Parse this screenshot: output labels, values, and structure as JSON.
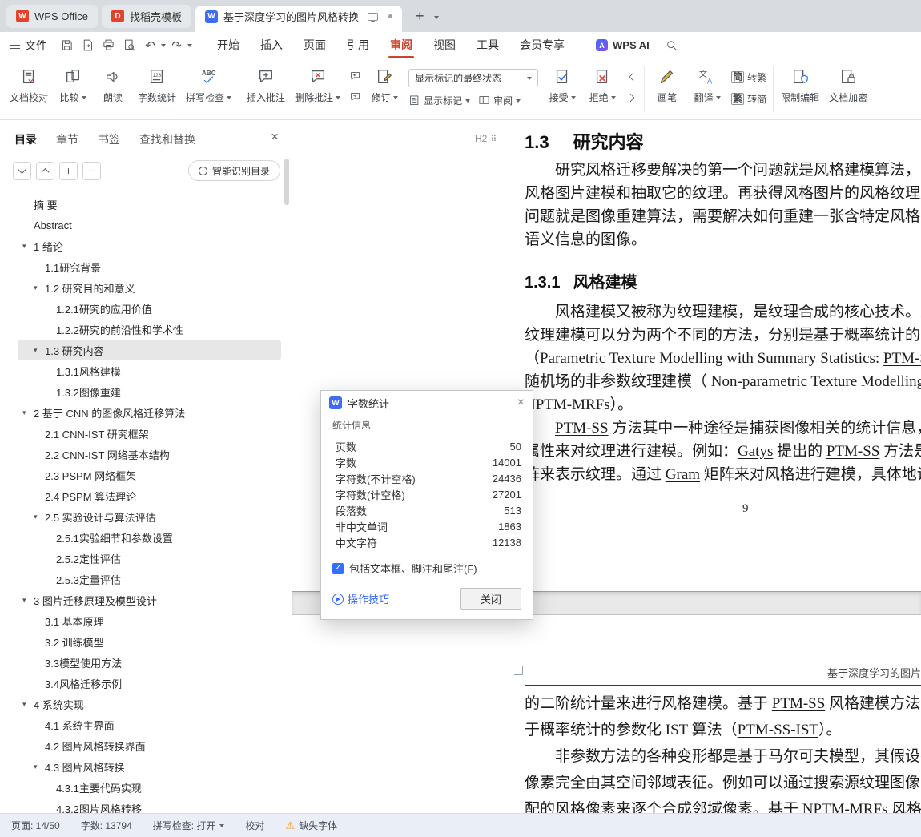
{
  "colors": {
    "accent_red": "#cf4229",
    "writer_blue": "#3d6df5",
    "docer_red": "#e2432f",
    "link_blue": "#3b6bf5",
    "warning_orange": "#f59a23",
    "toc_selected_gray": "#e7e7e7",
    "statusbar_bg": "#e9eef7"
  },
  "icons": {
    "wps_letter": "W",
    "writer_letter": "W",
    "docer_letter": "D",
    "ai_letter": "A",
    "plus": "+",
    "minus": "−",
    "close": "×",
    "undo": "↶",
    "redo": "↷",
    "check": "✓",
    "play": "▶",
    "warning": "⚠",
    "grip": "⠿",
    "triangle_down": "▾"
  },
  "tabbar": {
    "tabs": [
      {
        "label": "WPS Office"
      },
      {
        "label": "找稻壳模板"
      },
      {
        "label": "基于深度学习的图片风格转换"
      }
    ]
  },
  "menubar": {
    "file": "文件",
    "tabs": [
      "开始",
      "插入",
      "页面",
      "引用",
      "审阅",
      "视图",
      "工具",
      "会员专享"
    ],
    "wps_ai": "WPS AI"
  },
  "ribbon": {
    "doc_proof": "文档校对",
    "compare": "比较",
    "read_aloud": "朗读",
    "word_count": "字数统计",
    "spell_check": "拼写检查",
    "insert_comment": "插入批注",
    "delete_comment": "删除批注",
    "revise": "修订",
    "markup_state": "显示标记的最终状态",
    "show_markup": "显示标记",
    "review": "审阅",
    "accept": "接受",
    "reject": "拒绝",
    "brush": "画笔",
    "translate": "翻译",
    "to_traditional": "转繁",
    "to_simplified": "转简",
    "simp_char": "简",
    "trad_char": "繁",
    "restrict_edit": "限制编辑",
    "doc_encrypt": "文档加密"
  },
  "sidebar": {
    "tabs": [
      "目录",
      "章节",
      "书签",
      "查找和替换"
    ],
    "smart_toc": "智能识别目录",
    "toc": [
      {
        "label": "摘  要",
        "level": 0
      },
      {
        "label": "Abstract",
        "level": 0
      },
      {
        "label": "1 绪论",
        "level": 0,
        "exp": true
      },
      {
        "label": "1.1研究背景",
        "level": 1
      },
      {
        "label": "1.2 研究目的和意义",
        "level": 1,
        "exp": true
      },
      {
        "label": "1.2.1研究的应用价值",
        "level": 2
      },
      {
        "label": "1.2.2研究的前沿性和学术性",
        "level": 2
      },
      {
        "label": "1.3 研究内容",
        "level": 1,
        "exp": true,
        "selected": true
      },
      {
        "label": "1.3.1风格建模",
        "level": 2
      },
      {
        "label": "1.3.2图像重建",
        "level": 2
      },
      {
        "label": "2 基于 CNN 的图像风格迁移算法",
        "level": 0,
        "exp": true
      },
      {
        "label": "2.1 CNN-IST 研究框架",
        "level": 1
      },
      {
        "label": "2.2 CNN-IST 网络基本结构",
        "level": 1
      },
      {
        "label": "2.3 PSPM 网络框架",
        "level": 1
      },
      {
        "label": "2.4 PSPM 算法理论",
        "level": 1
      },
      {
        "label": "2.5 实验设计与算法评估",
        "level": 1,
        "exp": true
      },
      {
        "label": "2.5.1实验细节和参数设置",
        "level": 2
      },
      {
        "label": "2.5.2定性评估",
        "level": 2
      },
      {
        "label": "2.5.3定量评估",
        "level": 2
      },
      {
        "label": "3 图片迁移原理及模型设计",
        "level": 0,
        "exp": true
      },
      {
        "label": "3.1 基本原理",
        "level": 1
      },
      {
        "label": "3.2 训练模型",
        "level": 1
      },
      {
        "label": "3.3模型使用方法",
        "level": 1
      },
      {
        "label": "3.4风格迁移示例",
        "level": 1
      },
      {
        "label": "4 系统实现",
        "level": 0,
        "exp": true
      },
      {
        "label": "4.1 系统主界面",
        "level": 1
      },
      {
        "label": "4.2 图片风格转换界面",
        "level": 1
      },
      {
        "label": "4.3 图片风格转换",
        "level": 1,
        "exp": true
      },
      {
        "label": "4.3.1主要代码实现",
        "level": 2
      },
      {
        "label": "4.3.2图片风格转移",
        "level": 2
      }
    ]
  },
  "document": {
    "heading_marker": "H2",
    "page1": {
      "blocks": [
        {
          "type": "h2",
          "num": "1.3",
          "text": "研究内容"
        },
        {
          "type": "p",
          "lines": [
            "　　研究风格迁移要解决的第一个问题就是风格建模算法，需要解决如何对",
            "风格图片建模和抽取它的纹理。再获得风格图片的风格纹理后，下一个要解决",
            "问题就是图像重建算法，需要解决如何重建一张含特定风格并保留内容图片",
            "语义信息的图像。"
          ]
        },
        {
          "type": "h3",
          "num": "1.3.1",
          "text": "风格建模"
        },
        {
          "type": "p",
          "lines": [
            "　　风格建模又被称为纹理建模，是纹理合成的核心技术。从前人的工作来看",
            "纹理建模可以分为两个不同的方法，分别是基于概率统计的参数化纹理建模",
            "（Parametric Texture Modelling with Summary Statistics: __PTM-SS__）和基于马尔",
            "随机场的非参数纹理建模（ Non-parametric Texture Modelling with MRFs，",
            "__NPTM-MRFs__）。"
          ]
        },
        {
          "type": "p",
          "lines": [
            "　　__PTM-SS__ 方法其中一种途径是捕获图像相关的统计信息，并利用相似的统",
            "属性来对纹理进行建模。例如：__Gatys__ 提出的 __PTM-SS__ 方法是设计一个 __Gram__ 矩",
            "阵来表示纹理。通过 __Gram__ 矩阵来对风格进行建模，具体地说，就是利用了"
          ]
        },
        {
          "type": "pageno",
          "text": "9"
        }
      ]
    },
    "page2": {
      "header": "基于深度学习的图片风格转换",
      "blocks": [
        {
          "type": "p",
          "lines": [
            "的二阶统计量来进行风格建模。基于 __PTM-SS__ 风格建模方法的 IST 算法称为基",
            "于概率统计的参数化 IST 算法（__PTM-SS-IST__）。",
            "　　非参数方法的各种变形都是基于马尔可夫模型，其假设在纹理图像中每个",
            "像素完全由其空间邻域表征。例如可以通过搜索源纹理图像中的邻域匹",
            "配的风格像素来逐个合成邻域像素。基于 __NPTM-MRFs__ 风格建模方法的"
          ]
        }
      ]
    }
  },
  "dialog": {
    "title": "字数统计",
    "section": "统计信息",
    "stats": [
      {
        "label": "页数",
        "value": "50"
      },
      {
        "label": "字数",
        "value": "14001"
      },
      {
        "label": "字符数(不计空格)",
        "value": "24436"
      },
      {
        "label": "字符数(计空格)",
        "value": "27201"
      },
      {
        "label": "段落数",
        "value": "513"
      },
      {
        "label": "非中文单词",
        "value": "1863"
      },
      {
        "label": "中文字符",
        "value": "12138"
      }
    ],
    "checkbox": "包括文本框、脚注和尾注(F)",
    "tips": "操作技巧",
    "close": "关闭"
  },
  "statusbar": {
    "page": "页面: 14/50",
    "words": "字数: 13794",
    "spell": "拼写检查: 打开",
    "proof": "校对",
    "missing_font": "缺失字体"
  }
}
